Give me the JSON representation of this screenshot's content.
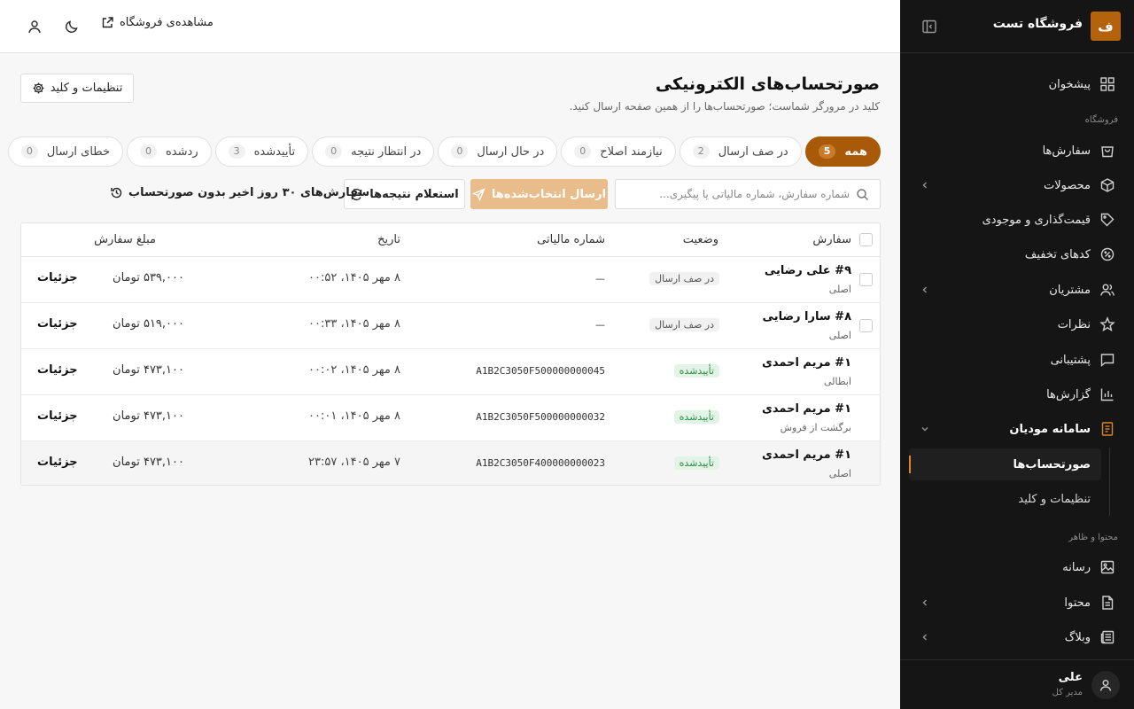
{
  "brand": {
    "logo_letter": "ف",
    "name": "فروشگاه تست"
  },
  "topbar": {
    "view_store": "مشاهده‌ی فروشگاه"
  },
  "nav": {
    "dashboard": "پیشخوان",
    "section_store": "فروشگاه",
    "orders": "سفارش‌ها",
    "products": "محصولات",
    "pricing": "قیمت‌گذاری و موجودی",
    "discounts": "کدهای تخفیف",
    "customers": "مشتریان",
    "reviews": "نظرات",
    "support": "پشتیبانی",
    "reports": "گزارش‌ها",
    "moadian": "سامانه مودیان",
    "sub_invoices": "صورتحساب‌ها",
    "sub_settings": "تنظیمات و کلید",
    "section_content": "محتوا و ظاهر",
    "media": "رسانه",
    "content": "محتوا",
    "blog": "وبلاگ"
  },
  "user": {
    "name": "علی",
    "role": "مدیر کل"
  },
  "page": {
    "title": "صورتحساب‌های الکترونیکی",
    "subtitle": "کلید در مرورگر شماست؛ صورتحساب‌ها را از همین صفحه ارسال کنید.",
    "settings_button": "تنظیمات و کلید"
  },
  "tabs": [
    {
      "label": "همه",
      "count": "5"
    },
    {
      "label": "در صف ارسال",
      "count": "2"
    },
    {
      "label": "نیازمند اصلاح",
      "count": "0"
    },
    {
      "label": "در حال ارسال",
      "count": "0"
    },
    {
      "label": "در انتظار نتیجه",
      "count": "0"
    },
    {
      "label": "تأییدشده",
      "count": "3"
    },
    {
      "label": "ردشده",
      "count": "0"
    },
    {
      "label": "خطای ارسال",
      "count": "0"
    }
  ],
  "toolbar": {
    "search_placeholder": "شماره سفارش، شماره مالیاتی یا پیگیری...",
    "send_selected": "ارسال انتخاب‌شده‌ها",
    "inquire_results": "استعلام نتیجه‌ها",
    "recent_orders": "سفارش‌های ۳۰ روز اخیر بدون صورتحساب"
  },
  "table": {
    "headers": {
      "order": "سفارش",
      "status": "وضعیت",
      "tax_id": "شماره مالیاتی",
      "date": "تاریخ",
      "amount": "مبلغ سفارش"
    },
    "details_label": "جزئیات",
    "rows": [
      {
        "order": "#۹ علی رضایی",
        "type": "اصلی",
        "status": "در صف ارسال",
        "status_kind": "queue",
        "tax_id": "—",
        "date": "۸ مهر ۱۴۰۵، ۰۰:۵۲",
        "amount": "۵۳۹,۰۰۰ تومان"
      },
      {
        "order": "#۸ سارا رضایی",
        "type": "اصلی",
        "status": "در صف ارسال",
        "status_kind": "queue",
        "tax_id": "—",
        "date": "۸ مهر ۱۴۰۵، ۰۰:۳۳",
        "amount": "۵۱۹,۰۰۰ تومان"
      },
      {
        "order": "#۱ مریم احمدی",
        "type": "ابطالی",
        "status": "تأییدشده",
        "status_kind": "ok",
        "tax_id": "A1B2C3050F500000000045",
        "date": "۸ مهر ۱۴۰۵، ۰۰:۰۲",
        "amount": "۴۷۳,۱۰۰ تومان"
      },
      {
        "order": "#۱ مریم احمدی",
        "type": "برگشت از فروش",
        "status": "تأییدشده",
        "status_kind": "ok",
        "tax_id": "A1B2C3050F500000000032",
        "date": "۸ مهر ۱۴۰۵، ۰۰:۰۱",
        "amount": "۴۷۳,۱۰۰ تومان"
      },
      {
        "order": "#۱ مریم احمدی",
        "type": "اصلی",
        "status": "تأییدشده",
        "status_kind": "ok",
        "tax_id": "A1B2C3050F400000000023",
        "date": "۷ مهر ۱۴۰۵، ۲۳:۵۷",
        "amount": "۴۷۳,۱۰۰ تومان"
      }
    ]
  },
  "colors": {
    "accent": "#a85a08",
    "sidebar_bg": "#151515",
    "success": "#2e8b45"
  }
}
